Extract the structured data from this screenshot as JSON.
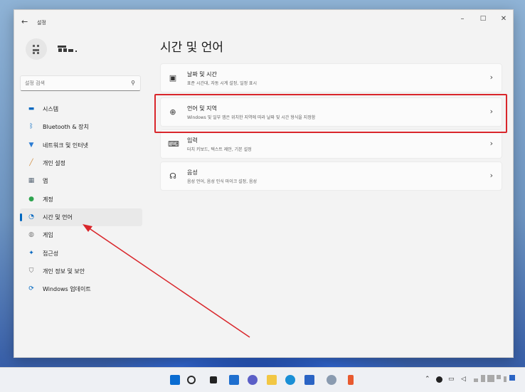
{
  "window": {
    "back_icon": "back-arrow-icon",
    "app_title": "설정",
    "minimize_glyph": "–",
    "maximize_glyph": "□",
    "close_glyph": "✕"
  },
  "search": {
    "placeholder": "설정 검색",
    "icon": "search-icon"
  },
  "sidebar": {
    "items": [
      {
        "label": "시스템",
        "icon": "monitor-icon",
        "color": "#0067c0"
      },
      {
        "label": "Bluetooth & 장치",
        "icon": "bluetooth-icon",
        "color": "#0067c0"
      },
      {
        "label": "네트워크 및 인터넷",
        "icon": "wifi-icon",
        "color": "#2b7cd3"
      },
      {
        "label": "개인 설정",
        "icon": "brush-icon",
        "color": "#d08a3a"
      },
      {
        "label": "앱",
        "icon": "apps-icon",
        "color": "#5d6b7a"
      },
      {
        "label": "계정",
        "icon": "account-icon",
        "color": "#2ea44f"
      },
      {
        "label": "시간 및 언어",
        "icon": "globe-clock-icon",
        "color": "#0067c0",
        "active": true
      },
      {
        "label": "게임",
        "icon": "gamepad-icon",
        "color": "#7a7a7a"
      },
      {
        "label": "접근성",
        "icon": "accessibility-icon",
        "color": "#0067c0"
      },
      {
        "label": "개인 정보 및 보안",
        "icon": "shield-icon",
        "color": "#6b6b6b"
      },
      {
        "label": "Windows 업데이트",
        "icon": "update-icon",
        "color": "#0067c0"
      }
    ]
  },
  "main": {
    "title": "시간 및 언어",
    "cards": [
      {
        "title": "날짜 및 시간",
        "desc": "표준 시간대, 자동 시계 설정, 일정 표시",
        "icon": "calendar-clock-icon"
      },
      {
        "title": "언어 및 지역",
        "desc": "Windows 및 일부 앱은 위치한 지역에 따라 날짜 및 시간 형식을 지정함",
        "icon": "language-icon"
      },
      {
        "title": "입력",
        "desc": "터치 키보드, 텍스트 제안, 기본 설정",
        "icon": "keyboard-icon"
      },
      {
        "title": "음성",
        "desc": "음성 언어, 음성 인식 마이크 설정, 음성",
        "icon": "speech-icon"
      }
    ]
  },
  "annotation": {
    "highlight_color": "#d9262b",
    "arrow_color": "#d9262b"
  },
  "taskbar": {
    "icons": [
      "start-icon",
      "search-icon",
      "task-view-icon",
      "widgets-icon",
      "chat-icon",
      "file-explorer-icon",
      "edge-icon",
      "store-icon",
      "settings-icon",
      "pinned-app-icon"
    ],
    "tray": [
      "chevron-up-icon",
      "network-icon",
      "volume-icon"
    ]
  }
}
